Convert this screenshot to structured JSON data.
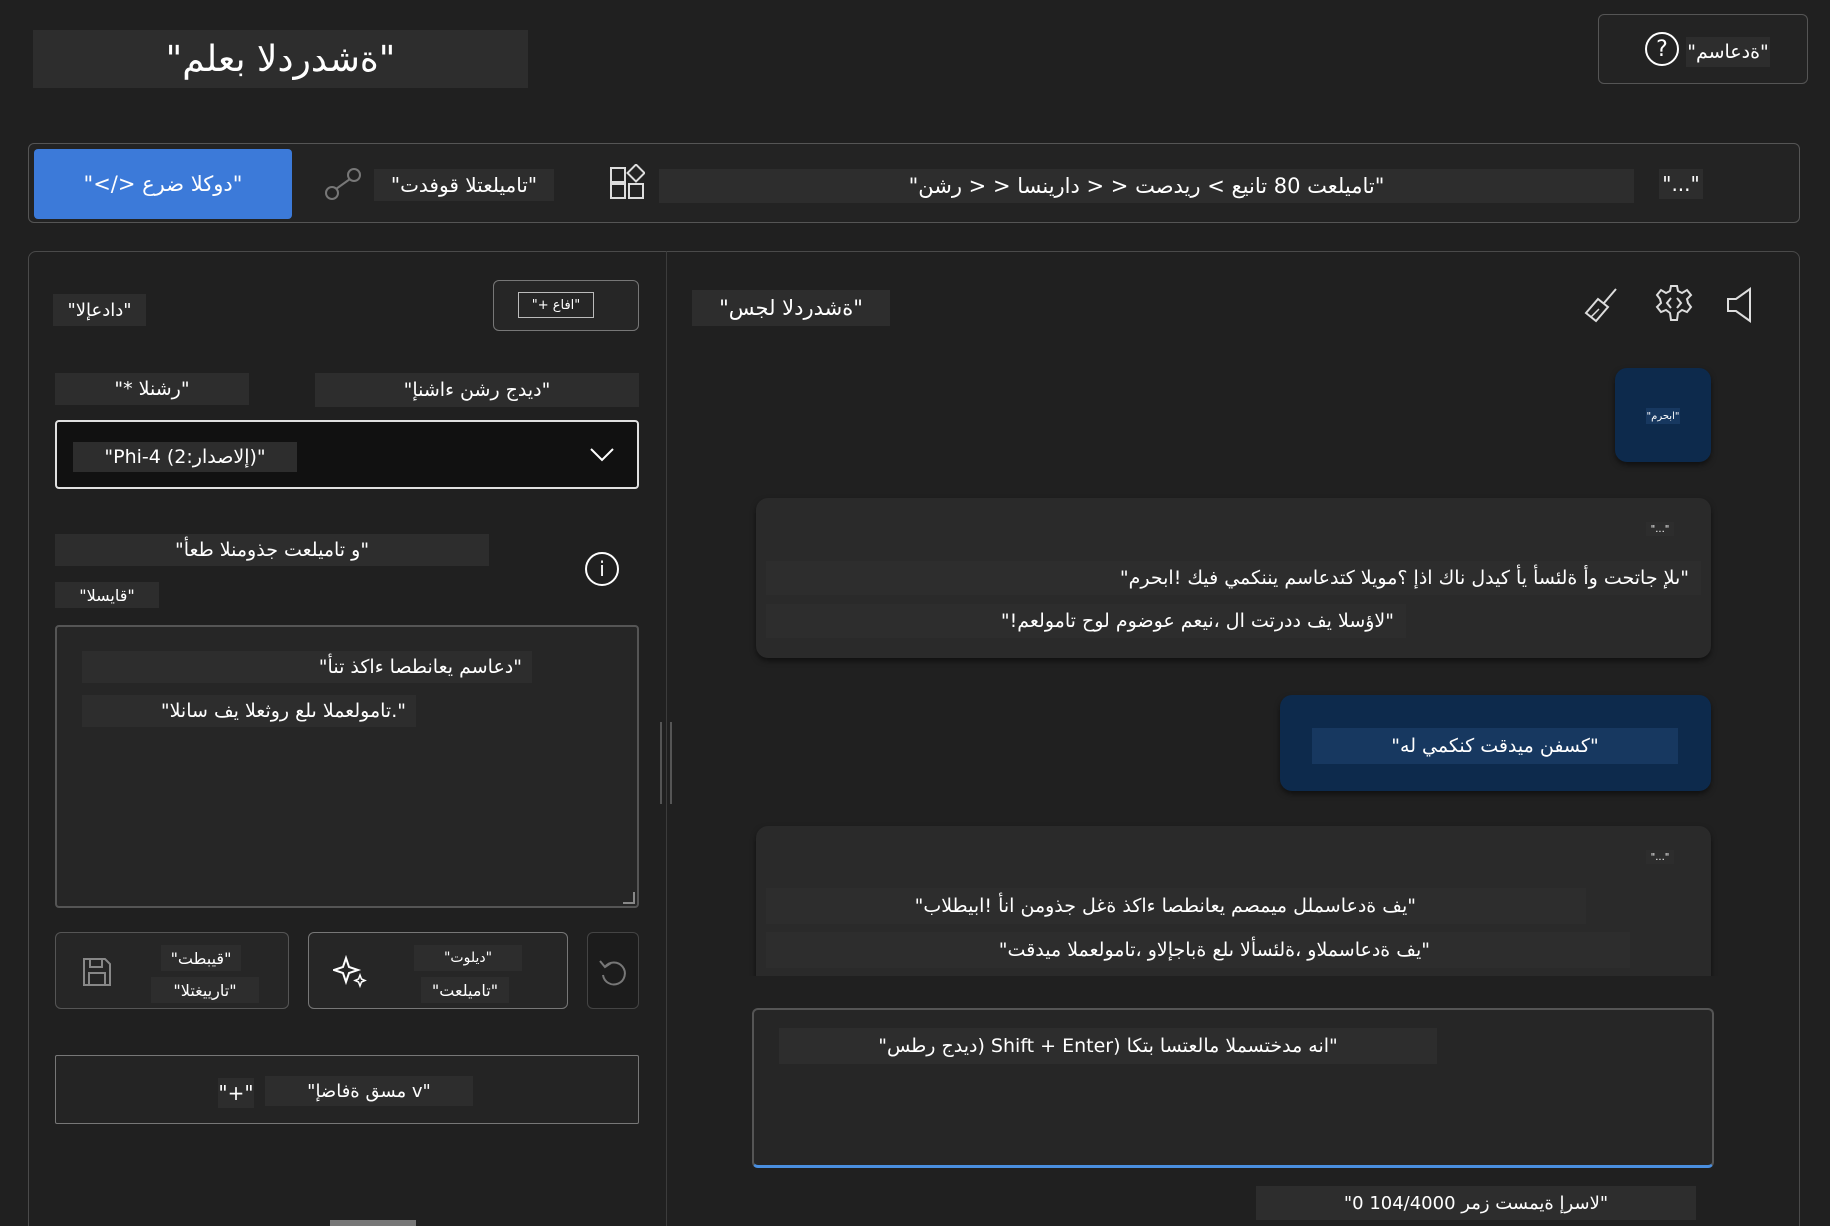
{
  "header": {
    "title": "\"ةشدردلا بعلم\"",
    "help_label": "\"ةدعاسم\""
  },
  "toolbar": {
    "view_code_label": "\"</> دوكلا ضرع\"",
    "compare_label": "\"تاميلعتلا قوفدت\"",
    "breadcrumb": "\"تاميلعت 80 تانيع > ريدصت < < دارينسا < < رشن\"",
    "more_label": "\"...\""
  },
  "settings": {
    "title": "\"دادعإلا\"",
    "add_label": "\"+ افاع\"",
    "model_label": "\"* رشنلا\"",
    "new_deployment_link": "\"ديدج رشن ءاشنإ\"",
    "model_value": "\"Phi-4 (إلاصدار:2)\"",
    "instructions_label": "\"و تاميلعت جذومنلا طعأ\"",
    "context_label": "\"قايسلا\"",
    "system_message": {
      "line1": "\"دعاسم يعانطصا ءاكذ تنأ\"",
      "line2": "\"تامولعملا ىلع روثعلا يف سانلا.\""
    },
    "save_label_1": "\"قيبطت\"",
    "save_label_2": "\"تارييغتلا\"",
    "generate_label_1": "\"ديلوت\"",
    "generate_label_2": "\"تاميلعت\"",
    "add_section_plus": "\"+\"",
    "add_section_label": "\"مسق ةفاضإ v\""
  },
  "chat": {
    "title": "\"ةشدردلا لجس\"",
    "messages": [
      {
        "role": "user",
        "text": "\"ابحرم\""
      },
      {
        "role": "assistant",
        "meta": "\"...\"",
        "line1": "\"ىلإ جاتحت وأ ةلئسأ يأ كيدل ناك اذإ ؟مويلا كتدعاسم يننكمي فيك !ابحرم\"",
        "line2": "\"!لاؤسلا يف ددرتت ال ،نيعم عوضوم لوح تامولعم\""
      },
      {
        "role": "user",
        "text": "\"كسفن ميدقت كنكمي له\""
      },
      {
        "role": "assistant",
        "meta": "\"...\"",
        "line1": "\"يف ةدعاسملل ميمصم يعانطصا ءاكذ ةغل جذومن انأ !ابيطلاب\"",
        "line2": "\"يف ةدعاسملاو ،ةلئسألا ىلع ةباجإلاو ،تامولعملا ميدقت\""
      }
    ],
    "input_placeholder": "\"ديدج رطس) Shift + Enter) انه مدختسملا مالعتسا بتكا\"",
    "token_count": "\"0 لاسرإ ةيمست زمر 104/4000\""
  },
  "colors": {
    "background": "#202020",
    "accent": "#3c7ad9",
    "user_bubble": "#0d2a4c",
    "assistant_bubble": "#2a2a2a"
  },
  "icons": [
    "help-icon",
    "compare-icon",
    "apps-icon",
    "chevron-down-icon",
    "info-icon",
    "save-icon",
    "sparkle-icon",
    "undo-icon",
    "broom-icon",
    "gear-icon",
    "speaker-icon"
  ]
}
